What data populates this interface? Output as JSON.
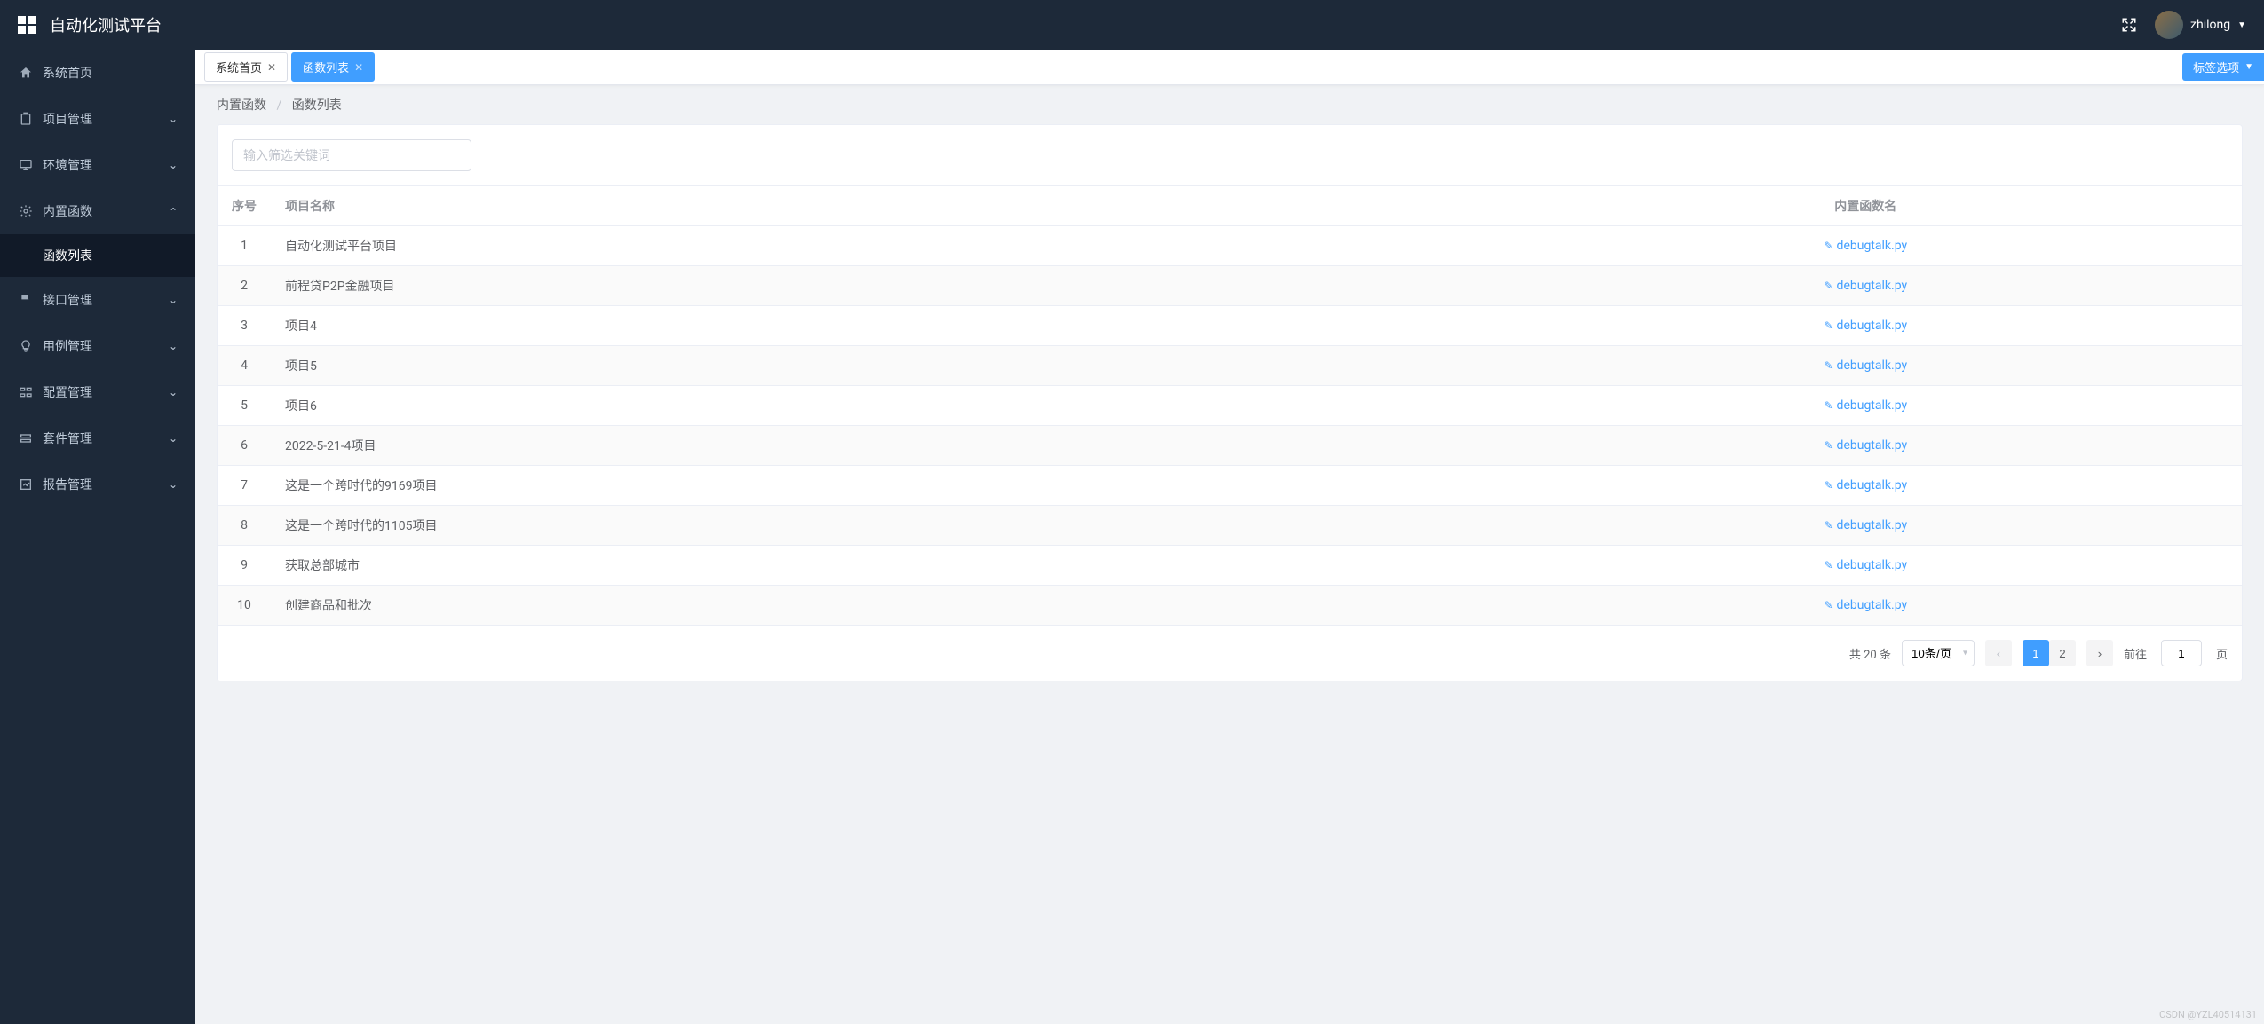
{
  "header": {
    "title": "自动化测试平台",
    "username": "zhilong"
  },
  "sidebar": {
    "items": [
      {
        "icon": "home",
        "label": "系统首页",
        "expandable": false
      },
      {
        "icon": "clipboard",
        "label": "项目管理",
        "expandable": true
      },
      {
        "icon": "monitor",
        "label": "环境管理",
        "expandable": true
      },
      {
        "icon": "gear",
        "label": "内置函数",
        "expandable": true,
        "open": true,
        "children": [
          {
            "label": "函数列表"
          }
        ]
      },
      {
        "icon": "flag",
        "label": "接口管理",
        "expandable": true
      },
      {
        "icon": "bulb",
        "label": "用例管理",
        "expandable": true
      },
      {
        "icon": "sliders",
        "label": "配置管理",
        "expandable": true
      },
      {
        "icon": "layers",
        "label": "套件管理",
        "expandable": true
      },
      {
        "icon": "chart",
        "label": "报告管理",
        "expandable": true
      }
    ]
  },
  "tabs": {
    "items": [
      {
        "label": "系统首页",
        "closable": true,
        "active": false
      },
      {
        "label": "函数列表",
        "closable": true,
        "active": true
      }
    ],
    "options_label": "标签选项"
  },
  "breadcrumb": {
    "root": "内置函数",
    "current": "函数列表"
  },
  "filter": {
    "placeholder": "输入筛选关键词",
    "value": ""
  },
  "table": {
    "columns": {
      "idx": "序号",
      "name": "项目名称",
      "func": "内置函数名"
    },
    "rows": [
      {
        "idx": "1",
        "name": "自动化测试平台项目",
        "func": "debugtalk.py"
      },
      {
        "idx": "2",
        "name": "前程贷P2P金融项目",
        "func": "debugtalk.py"
      },
      {
        "idx": "3",
        "name": "项目4",
        "func": "debugtalk.py"
      },
      {
        "idx": "4",
        "name": "项目5",
        "func": "debugtalk.py"
      },
      {
        "idx": "5",
        "name": "项目6",
        "func": "debugtalk.py"
      },
      {
        "idx": "6",
        "name": "2022-5-21-4项目",
        "func": "debugtalk.py"
      },
      {
        "idx": "7",
        "name": "这是一个跨时代的9169项目",
        "func": "debugtalk.py"
      },
      {
        "idx": "8",
        "name": "这是一个跨时代的1105项目",
        "func": "debugtalk.py"
      },
      {
        "idx": "9",
        "name": "获取总部城市",
        "func": "debugtalk.py"
      },
      {
        "idx": "10",
        "name": "创建商品和批次",
        "func": "debugtalk.py"
      }
    ]
  },
  "pagination": {
    "total_label": "共 20 条",
    "page_size_label": "10条/页",
    "pages": [
      "1",
      "2"
    ],
    "current": "1",
    "jump_prefix": "前往",
    "jump_value": "1",
    "jump_suffix": "页"
  },
  "watermark": "CSDN @YZL40514131"
}
